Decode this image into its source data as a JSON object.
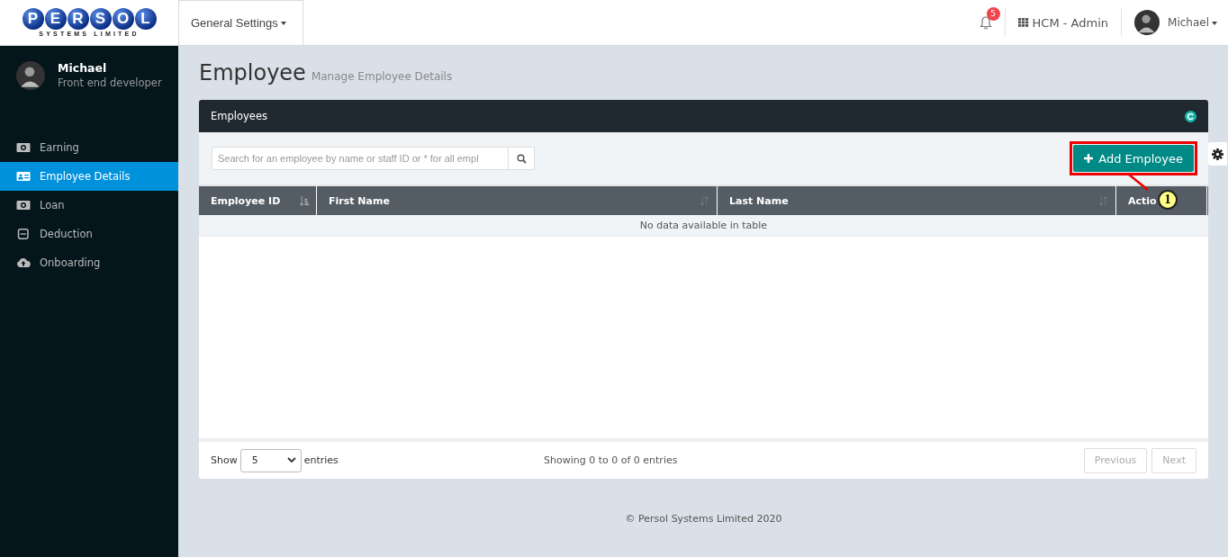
{
  "logo": {
    "letters": [
      "P",
      "E",
      "R",
      "S",
      "O",
      "L"
    ],
    "tagline": "SYSTEMS LIMITED"
  },
  "topbar": {
    "menu": "General Settings",
    "notifications": "5",
    "app": "HCM - Admin",
    "user": "Michael"
  },
  "sidebar": {
    "profile": {
      "name": "Michael",
      "role": "Front end developer"
    },
    "items": [
      {
        "label": "Earning",
        "kind": "money",
        "selected": false
      },
      {
        "label": "Employee Details",
        "kind": "card",
        "selected": true
      },
      {
        "label": "Loan",
        "kind": "money",
        "selected": false
      },
      {
        "label": "Deduction",
        "kind": "minus",
        "selected": false
      },
      {
        "label": "Onboarding",
        "kind": "cloud",
        "selected": false
      }
    ]
  },
  "page": {
    "title": "Employee",
    "subtitle": "Manage Employee Details"
  },
  "panel": {
    "title": "Employees",
    "search": {
      "placeholder": "Search for an employee by name or staff ID or * for all empl"
    },
    "add_button": "Add Employee",
    "callout": "1",
    "table": {
      "columns": [
        {
          "label": "Employee ID",
          "kind": "sorted"
        },
        {
          "label": "First Name",
          "kind": "sortable"
        },
        {
          "label": "Last Name",
          "kind": "sortable"
        },
        {
          "label": "Actio",
          "kind": "plain"
        }
      ],
      "empty": "No data available in table"
    },
    "length": {
      "before": "Show",
      "value": "5",
      "after": "entries"
    },
    "info": "Showing 0 to 0 of 0 entries",
    "pager": [
      {
        "label": "Previous",
        "disabled": true
      },
      {
        "label": "Next",
        "disabled": true
      }
    ]
  },
  "footer": "© Persol Systems Limited 2020"
}
